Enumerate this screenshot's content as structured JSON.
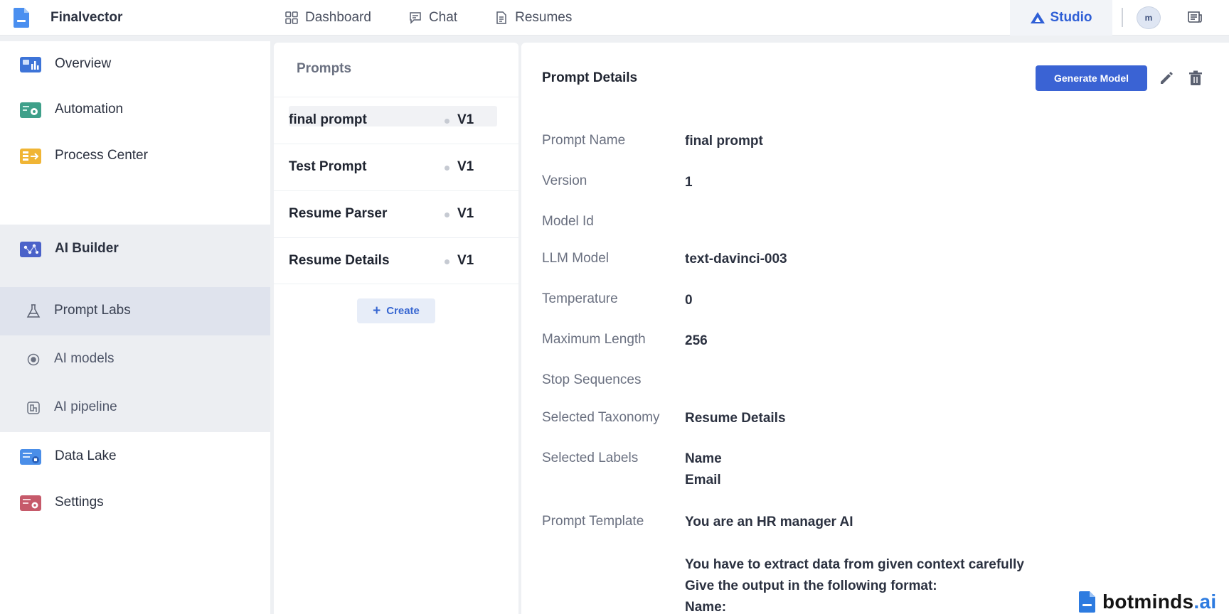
{
  "app": {
    "name": "Finalvector"
  },
  "topnav": [
    {
      "label": "Dashboard",
      "icon": "grid-icon"
    },
    {
      "label": "Chat",
      "icon": "chat-icon"
    },
    {
      "label": "Resumes",
      "icon": "document-icon"
    }
  ],
  "studio": {
    "label": "Studio",
    "icon": "studio-logo-icon"
  },
  "user": {
    "avatar_text": "m"
  },
  "sidebar": {
    "items": [
      {
        "label": "Overview",
        "icon": "overview-icon"
      },
      {
        "label": "Automation",
        "icon": "automation-icon"
      },
      {
        "label": "Process Center",
        "icon": "process-center-icon"
      },
      {
        "label": "AI Builder",
        "icon": "ai-builder-icon"
      },
      {
        "label": "Data Lake",
        "icon": "data-lake-icon"
      },
      {
        "label": "Settings",
        "icon": "settings-icon"
      }
    ],
    "subitems": [
      {
        "label": "Prompt Labs",
        "icon": "flask-icon",
        "active": true
      },
      {
        "label": "AI models",
        "icon": "model-icon"
      },
      {
        "label": "AI pipeline",
        "icon": "pipeline-icon"
      }
    ]
  },
  "prompts": {
    "title": "Prompts",
    "items": [
      {
        "name": "final prompt",
        "version": "V1",
        "selected": true
      },
      {
        "name": "Test Prompt",
        "version": "V1"
      },
      {
        "name": "Resume Parser",
        "version": "V1"
      },
      {
        "name": "Resume Details",
        "version": "V1"
      }
    ],
    "create_label": "Create"
  },
  "detail": {
    "title": "Prompt Details",
    "generate_label": "Generate Model",
    "fields": {
      "prompt_name": {
        "label": "Prompt Name",
        "value": "final prompt"
      },
      "version": {
        "label": "Version",
        "value": "1"
      },
      "model_id": {
        "label": "Model Id",
        "value": ""
      },
      "llm_model": {
        "label": "LLM Model",
        "value": "text-davinci-003"
      },
      "temperature": {
        "label": "Temperature",
        "value": "0"
      },
      "max_length": {
        "label": "Maximum Length",
        "value": "256"
      },
      "stop_sequences": {
        "label": "Stop Sequences",
        "value": ""
      },
      "taxonomy": {
        "label": "Selected Taxonomy",
        "value": "Resume Details"
      },
      "labels": {
        "label": "Selected Labels",
        "values": [
          "Name",
          "Email"
        ]
      },
      "template": {
        "label": "Prompt Template",
        "lines": [
          "You are an HR manager AI",
          "",
          "You have to extract data from given context carefully",
          "Give the output in the following format:",
          "Name:"
        ]
      }
    }
  },
  "watermark": {
    "brand": "botminds",
    "suffix": ".ai"
  },
  "colors": {
    "accent": "#3a63d4",
    "studio": "#2f5fd6",
    "brand_blue": "#2d7be0"
  }
}
